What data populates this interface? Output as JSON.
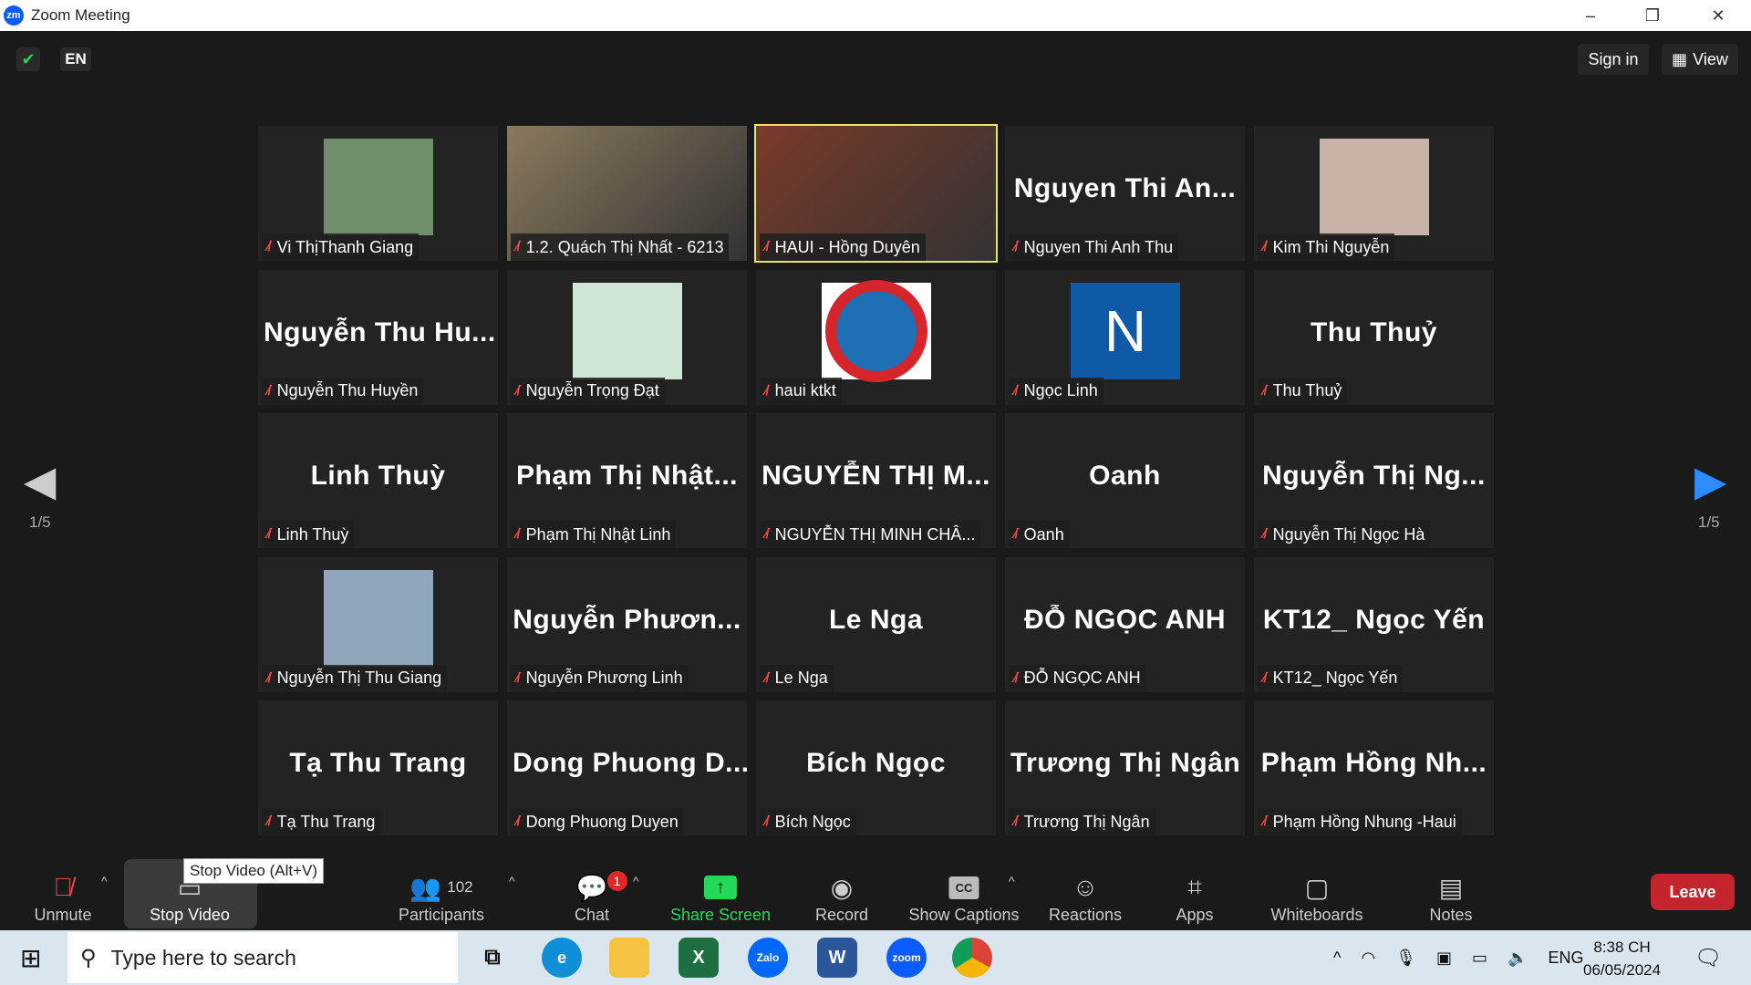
{
  "window": {
    "title": "Zoom Meeting",
    "logo": "zm",
    "minimize": "–",
    "restore": "❐",
    "close": "✕"
  },
  "topbar": {
    "language": "EN",
    "sign_in": "Sign in",
    "view": "View",
    "shield_icon": "shield-check-icon"
  },
  "gallery": {
    "page_left": "1/5",
    "page_right": "1/5",
    "tiles": [
      {
        "big": "",
        "label": "Vi ThịThanh Giang",
        "kind": "photo",
        "color": "#6d8f6a"
      },
      {
        "big": "",
        "label": "1.2. Quách Thị Nhất - 6213",
        "kind": "video",
        "color": "#8a7a5e"
      },
      {
        "big": "",
        "label": "HAUI - Hồng Duyên",
        "kind": "video",
        "color": "#7a3a2a",
        "active": true
      },
      {
        "big": "Nguyen Thi An...",
        "label": "Nguyen Thi Anh Thu"
      },
      {
        "big": "",
        "label": "Kim Thi Nguyễn",
        "kind": "photo",
        "color": "#c9b3a8"
      },
      {
        "big": "Nguyễn Thu Hu...",
        "label": "Nguyễn Thu Huyền"
      },
      {
        "big": "",
        "label": "Nguyễn Trọng Đạt",
        "kind": "photo",
        "color": "#cfe6d6"
      },
      {
        "big": "",
        "label": "haui ktkt",
        "kind": "logo",
        "color": "#1f6fb5"
      },
      {
        "big": "",
        "label": "Ngọc Linh",
        "kind": "letter",
        "letter": "N",
        "color": "#0e5aa7"
      },
      {
        "big": "Thu Thuỷ",
        "label": "Thu Thuỷ"
      },
      {
        "big": "Linh Thuỳ",
        "label": "Linh Thuỳ"
      },
      {
        "big": "Phạm Thị Nhật...",
        "label": "Phạm Thị Nhật Linh"
      },
      {
        "big": "NGUYỄN THỊ M...",
        "label": "NGUYỄN THỊ MINH CHÂ..."
      },
      {
        "big": "Oanh",
        "label": "Oanh"
      },
      {
        "big": "Nguyễn Thị Ng...",
        "label": "Nguyễn Thị Ngọc Hà"
      },
      {
        "big": "",
        "label": "Nguyễn Thị Thu Giang",
        "kind": "photo",
        "color": "#8fa6bd"
      },
      {
        "big": "Nguyễn Phươn...",
        "label": "Nguyễn Phương Linh"
      },
      {
        "big": "Le Nga",
        "label": "Le Nga"
      },
      {
        "big": "ĐỖ NGỌC ANH",
        "label": "ĐỖ NGỌC ANH"
      },
      {
        "big": "KT12_ Ngọc Yến",
        "label": "KT12_ Ngọc Yến"
      },
      {
        "big": "Tạ Thu Trang",
        "label": "Tạ Thu Trang"
      },
      {
        "big": "Dong Phuong D...",
        "label": "Dong Phuong Duyen"
      },
      {
        "big": "Bích Ngọc",
        "label": "Bích Ngọc"
      },
      {
        "big": "Trương Thị Ngân",
        "label": "Trương Thị Ngân"
      },
      {
        "big": "Phạm Hồng Nh...",
        "label": "Phạm Hồng Nhung -Haui"
      }
    ]
  },
  "toolbar": {
    "unmute": "Unmute",
    "stop_video": "Stop Video",
    "tooltip": "Stop Video (Alt+V)",
    "participants": "Participants",
    "participant_count": "102",
    "chat": "Chat",
    "chat_badge": "1",
    "share_screen": "Share Screen",
    "record": "Record",
    "show_captions": "Show Captions",
    "cc": "CC",
    "reactions": "Reactions",
    "apps": "Apps",
    "whiteboards": "Whiteboards",
    "notes": "Notes",
    "leave": "Leave",
    "colors": {
      "share": "#23d959",
      "leave": "#c4242b",
      "muted": "#e8474b"
    }
  },
  "taskbar": {
    "search_placeholder": "Type here to search",
    "language": "ENG",
    "time": "8:38 CH",
    "date": "06/05/2024",
    "apps": [
      {
        "name": "excel",
        "glyph": "X",
        "color": "#1d6f42"
      },
      {
        "name": "zalo",
        "glyph": "Zalo",
        "color": "#0068ff"
      },
      {
        "name": "word",
        "glyph": "W",
        "color": "#2b579a"
      },
      {
        "name": "zoom",
        "glyph": "zoom",
        "color": "#0b5cff"
      }
    ]
  }
}
